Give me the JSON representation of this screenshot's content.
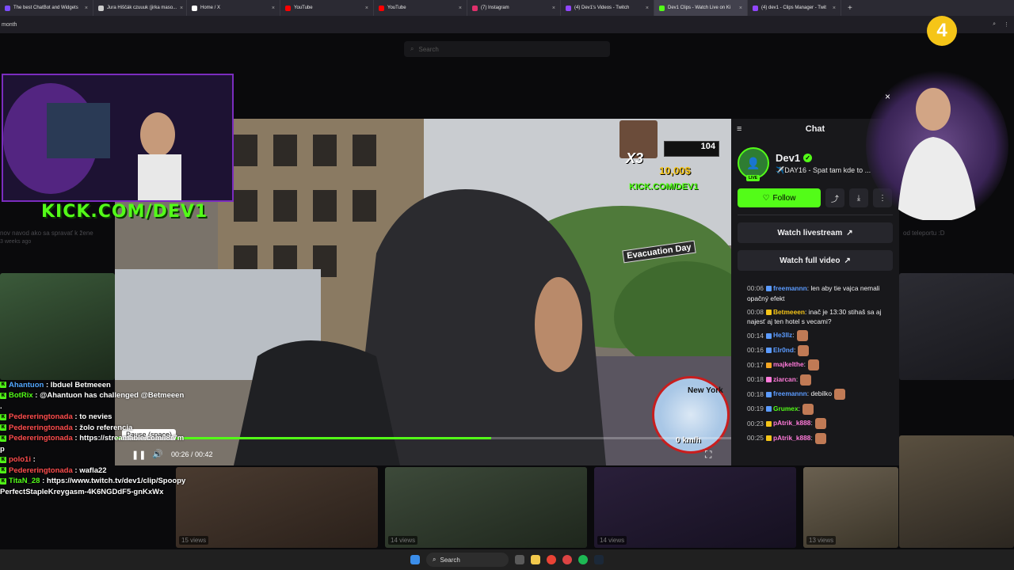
{
  "browser": {
    "tabs": [
      {
        "label": "The best ChatBot and Widgets",
        "color": "#7c4dff"
      },
      {
        "label": "Jura Hiščák czuuuk (jirka maso...",
        "color": "#cccccc"
      },
      {
        "label": "Home / X",
        "color": "#ffffff"
      },
      {
        "label": "YouTube",
        "color": "#ff0000"
      },
      {
        "label": "YouTube",
        "color": "#ff0000"
      },
      {
        "label": "(7) Instagram",
        "color": "#e1306c"
      },
      {
        "label": "(4) Dev1's Videos - Twitch",
        "color": "#9146ff"
      },
      {
        "label": "Dev1 Clips - Watch Live on Ki",
        "color": "#53fc18"
      },
      {
        "label": "(4) dev1 - Clips Manager - Twit",
        "color": "#9146ff"
      }
    ],
    "active_tab": 7,
    "url_fragment": "month"
  },
  "page": {
    "search_placeholder": "Search",
    "bg_text": [
      "weeks ago",
      "nov navod ako sa spravať k žene",
      "3 weeks ago",
      "od teleportu :D"
    ],
    "tile_views": [
      "15 views",
      "14 views",
      "14 views",
      "13 views"
    ]
  },
  "overlay": {
    "kick_text": "KICK.COM/DEV1",
    "left_chat": [
      {
        "user": "Ahantuon",
        "text": "lbduel Betmeeen",
        "color": "#53a7ff"
      },
      {
        "user": "BotRix",
        "text": "@Ahantuon has challenged @Betmeeen .",
        "color": "#53fc18"
      },
      {
        "user": "Pedereringtonada",
        "text": "to nevies",
        "color": "#ff4d4d"
      },
      {
        "user": "Pedereringtonada",
        "text": "žolo referencia",
        "color": "#ff4d4d"
      },
      {
        "user": "Pedereringtonada",
        "text": "https://streamable.com/l8r7mp",
        "color": "#ff4d4d"
      },
      {
        "user": "polo1i",
        "text": "",
        "color": "#ff4d4d"
      },
      {
        "user": "Pedereringtonada",
        "text": "wafla22",
        "color": "#ff4d4d"
      },
      {
        "user": "TitaN_28",
        "text": "https://www.twitch.tv/dev1/clip/SpoopyPerfectStapleKreygasm-4K6NGDdF5-gnKxWx",
        "color": "#53fc18"
      }
    ],
    "logo_text": "4"
  },
  "player": {
    "tooltip": "Pause (space)",
    "time": "00:26 / 00:42",
    "progress": 0.61,
    "hud": {
      "multiplier": "X3",
      "money": "10,00$",
      "score": "104",
      "kick_url": "KICK.COM/DEV1",
      "street": "Evacuation Day",
      "speed": "0 km/h",
      "city": "New York"
    }
  },
  "chat": {
    "title": "Chat",
    "streamer": "Dev1",
    "live_label": "LIVE",
    "stream_title": "✈️DAY16 - Spat tam kde to ...",
    "follow_label": "Follow",
    "watch_livestream": "Watch livestream",
    "watch_full_video": "Watch full video",
    "messages": [
      {
        "time": "00:06",
        "user": "freemannn",
        "text": ": len aby tie vajca nemali opačný efekt",
        "color": "#5b9bff",
        "badge": "#5b9bff"
      },
      {
        "time": "00:08",
        "user": "Betmeeen",
        "text": ": inač je 13:30 stihaš sa aj najesť aj ten hotel s vecami?",
        "color": "#f5c518",
        "badge": "#f5c518"
      },
      {
        "time": "00:14",
        "user": "He3llz",
        "text": ":",
        "color": "#5b9bff",
        "badge": "#5b9bff",
        "emote": true
      },
      {
        "time": "00:16",
        "user": "Elr0nd",
        "text": ":",
        "color": "#5b9bff",
        "badge": "#5b9bff",
        "emote": true
      },
      {
        "time": "00:17",
        "user": "majkelthe",
        "text": ":",
        "color": "#ff7ad9",
        "badge": "#f5a623",
        "emote": true
      },
      {
        "time": "00:18",
        "user": "ziarcan",
        "text": ":",
        "color": "#ff7ad9",
        "badge": "#ff7ad9",
        "emote": true
      },
      {
        "time": "00:18",
        "user": "freemannn",
        "text": ": debilko",
        "color": "#5b9bff",
        "badge": "#5b9bff",
        "emote": true
      },
      {
        "time": "00:19",
        "user": "Grumex",
        "text": ":",
        "color": "#53fc18",
        "badge": "#5b9bff",
        "emote": true
      },
      {
        "time": "00:23",
        "user": "pAtrik_k888",
        "text": ":",
        "color": "#ff7ad9",
        "badge": "#f5c518",
        "emote": true
      },
      {
        "time": "00:25",
        "user": "pAtrik_k888",
        "text": ":",
        "color": "#ff7ad9",
        "badge": "#f5c518",
        "emote": true
      }
    ]
  },
  "taskbar": {
    "search_label": "Search"
  },
  "colors": {
    "kick_green": "#53fc18",
    "bg": "#0e0e10",
    "panel": "#18181b"
  }
}
